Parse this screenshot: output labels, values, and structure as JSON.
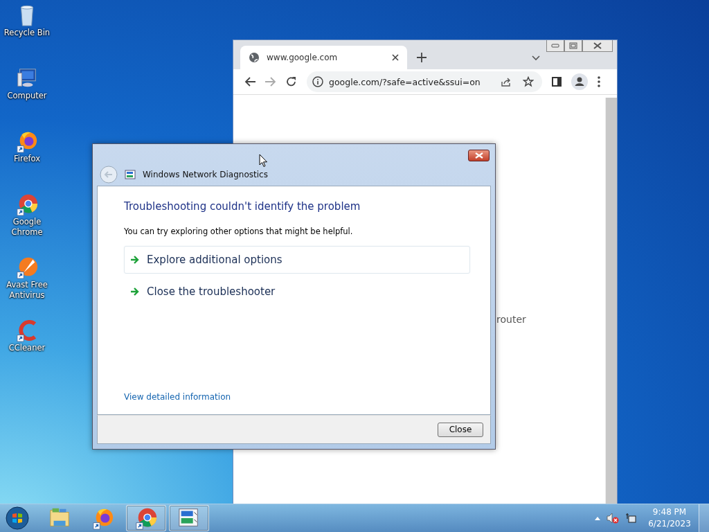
{
  "desktop_icons": [
    {
      "kind": "recycle",
      "label": "Recycle Bin"
    },
    {
      "kind": "computer",
      "label": "Computer"
    },
    {
      "kind": "firefox",
      "label": "Firefox"
    },
    {
      "kind": "chrome",
      "label": "Google Chrome"
    },
    {
      "kind": "avast",
      "label": "Avast Free Antivirus"
    },
    {
      "kind": "ccleaner",
      "label": "CCleaner"
    }
  ],
  "browser": {
    "tab_title": "www.google.com",
    "address": "google.com/?safe=active&ssui=on",
    "page_text": "router"
  },
  "dialog": {
    "title": "Windows Network Diagnostics",
    "heading": "Troubleshooting couldn't identify the problem",
    "message": "You can try exploring other options that might be helpful.",
    "options": [
      {
        "label": "Explore additional options",
        "highlighted": true
      },
      {
        "label": "Close the troubleshooter",
        "highlighted": false
      }
    ],
    "details_link": "View detailed information",
    "close_button": "Close"
  },
  "taskbar": {
    "apps": [
      {
        "kind": "explorer",
        "running": false
      },
      {
        "kind": "firefox",
        "running": false
      },
      {
        "kind": "chrome",
        "running": true
      },
      {
        "kind": "network",
        "running": true
      }
    ],
    "time": "9:48 PM",
    "date": "6/21/2023"
  }
}
